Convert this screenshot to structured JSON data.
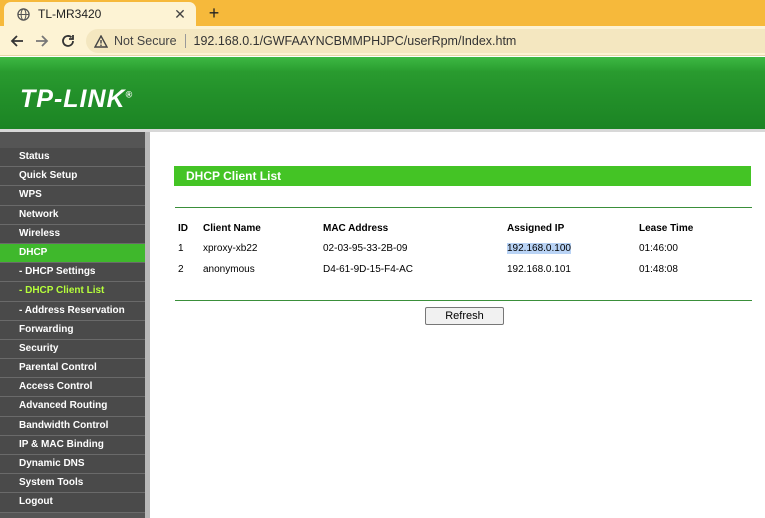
{
  "browser": {
    "tab_title": "TL-MR3420",
    "not_secure_label": "Not Secure",
    "url": "192.168.0.1/GWFAAYNCBMMPHJPC/userRpm/Index.htm"
  },
  "router": {
    "logo_text": "TP-LINK",
    "logo_mark": "®",
    "menu": [
      {
        "label": "Status"
      },
      {
        "label": "Quick Setup"
      },
      {
        "label": "WPS"
      },
      {
        "label": "Network"
      },
      {
        "label": "Wireless"
      },
      {
        "label": "DHCP"
      },
      {
        "label": "- DHCP Settings"
      },
      {
        "label": "- DHCP Client List"
      },
      {
        "label": "- Address Reservation"
      },
      {
        "label": "Forwarding"
      },
      {
        "label": "Security"
      },
      {
        "label": "Parental Control"
      },
      {
        "label": "Access Control"
      },
      {
        "label": "Advanced Routing"
      },
      {
        "label": "Bandwidth Control"
      },
      {
        "label": "IP & MAC Binding"
      },
      {
        "label": "Dynamic DNS"
      },
      {
        "label": "System Tools"
      },
      {
        "label": "Logout"
      }
    ],
    "section_title": "DHCP Client List",
    "table": {
      "headers": [
        "ID",
        "Client Name",
        "MAC Address",
        "Assigned IP",
        "Lease Time"
      ],
      "rows": [
        [
          "1",
          "xproxy-xb22",
          "02-03-95-33-2B-09",
          "192.168.0.100",
          "01:46:00"
        ],
        [
          "2",
          "anonymous",
          "D4-61-9D-15-F4-AC",
          "192.168.0.101",
          "01:48:08"
        ]
      ]
    },
    "refresh_label": "Refresh"
  },
  "colors": {
    "banner_green": "#23912a",
    "section_green": "#44c425",
    "menu_active": "#3fb82c",
    "submenu_active_text": "#b6ff3b",
    "tabstrip": "#f6b93b"
  }
}
